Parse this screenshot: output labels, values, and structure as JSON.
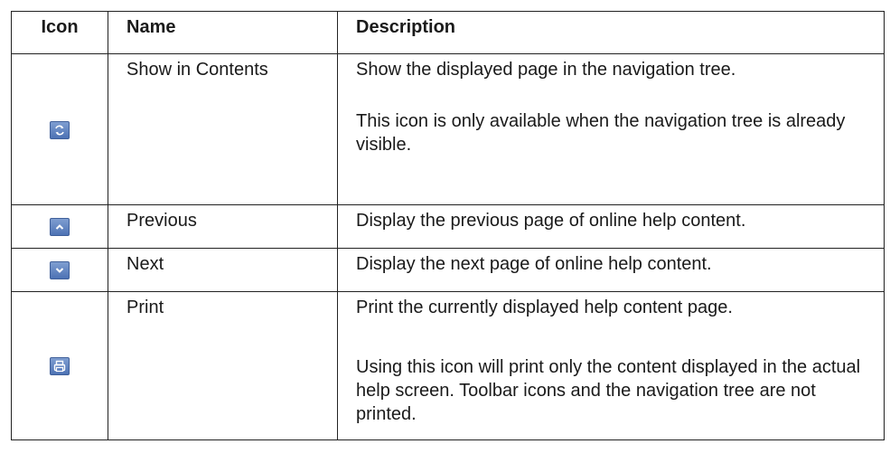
{
  "table": {
    "headers": {
      "icon": "Icon",
      "name": "Name",
      "description": "Description"
    },
    "rows": [
      {
        "icon": "show-in-contents-icon",
        "name": "Show in Contents",
        "description": [
          "Show the displayed page in the navigation tree.",
          "This icon is only available when the navigation tree is already visible."
        ]
      },
      {
        "icon": "previous-icon",
        "name": "Previous",
        "description": [
          "Display the previous page of online help content."
        ]
      },
      {
        "icon": "next-icon",
        "name": "Next",
        "description": [
          "Display the next page of online help content."
        ]
      },
      {
        "icon": "print-icon",
        "name": "Print",
        "description": [
          "Print the currently displayed help content page.",
          "Using this icon will print only the content displayed in the actual help screen.  Toolbar icons and the navigation tree are not printed."
        ]
      }
    ]
  },
  "colors": {
    "icon_fill": "#5c7fc0",
    "border": "#222222"
  }
}
